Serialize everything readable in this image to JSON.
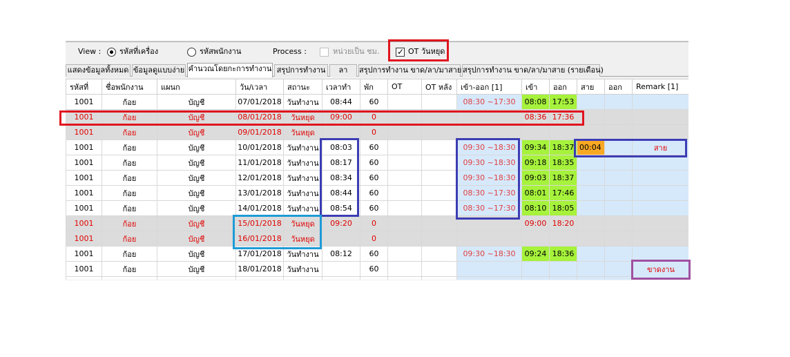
{
  "viewbar": {
    "view_label": "View :",
    "radio_machine_code": "รหัสที่เครื่อง",
    "radio_employee_code": "รหัสพนักงาน",
    "process_label": "Process :",
    "hour_unit_label": "หน่วยเป็น ชม.",
    "ot_holiday_label": "OT วันหยุด"
  },
  "tabs": [
    {
      "label": "แสดงข้อมูลทั้งหมด"
    },
    {
      "label": "ข้อมูลดูแบบง่าย"
    },
    {
      "label": "คำนวณโดยกะการทำงาน"
    },
    {
      "label": "สรุปการทำงาน"
    },
    {
      "label": "ลา"
    },
    {
      "label": "สรุปการทำงาน ขาด/ลา/มาสาย"
    },
    {
      "label": "สรุปการทำงาน ขาด/ลา/มาสาย (รายเดือน)"
    }
  ],
  "columns": [
    "รหัสที่",
    "ชื่อพนักงาน",
    "แผนก",
    "วัน/เวลา",
    "สถานะ",
    "เวลาทำ",
    "พัก",
    "OT",
    "OT หลัง",
    "เข้า-ออก [1]",
    "เข้า",
    "ออก",
    "สาย",
    "ออก",
    "Remark [1]"
  ],
  "rows": [
    {
      "id": "1001",
      "name": "ก้อย",
      "dept": "บัญชี",
      "date": "07/01/2018",
      "status": "วันทำงาน",
      "work": "08:44",
      "brk": "60",
      "ot": "",
      "ot_after": "",
      "shift": "08:30 ~17:30",
      "in": "08:08",
      "out": "17:53",
      "late": "",
      "early": "",
      "remark": ""
    },
    {
      "id": "1001",
      "name": "ก้อย",
      "dept": "บัญชี",
      "date": "08/01/2018",
      "status": "วันหยุด",
      "work": "09:00",
      "brk": "0",
      "ot": "",
      "ot_after": "",
      "shift": "",
      "in": "08:36",
      "out": "17:36",
      "late": "",
      "early": "",
      "remark": ""
    },
    {
      "id": "1001",
      "name": "ก้อย",
      "dept": "บัญชี",
      "date": "09/01/2018",
      "status": "วันหยุด",
      "work": "",
      "brk": "0",
      "ot": "",
      "ot_after": "",
      "shift": "",
      "in": "",
      "out": "",
      "late": "",
      "early": "",
      "remark": ""
    },
    {
      "id": "1001",
      "name": "ก้อย",
      "dept": "บัญชี",
      "date": "10/01/2018",
      "status": "วันทำงาน",
      "work": "08:03",
      "brk": "60",
      "ot": "",
      "ot_after": "",
      "shift": "09:30 ~18:30",
      "in": "09:34",
      "out": "18:37",
      "late": "00:04",
      "early": "",
      "remark": "สาย"
    },
    {
      "id": "1001",
      "name": "ก้อย",
      "dept": "บัญชี",
      "date": "11/01/2018",
      "status": "วันทำงาน",
      "work": "08:17",
      "brk": "60",
      "ot": "",
      "ot_after": "",
      "shift": "09:30 ~18:30",
      "in": "09:18",
      "out": "18:35",
      "late": "",
      "early": "",
      "remark": ""
    },
    {
      "id": "1001",
      "name": "ก้อย",
      "dept": "บัญชี",
      "date": "12/01/2018",
      "status": "วันทำงาน",
      "work": "08:34",
      "brk": "60",
      "ot": "",
      "ot_after": "",
      "shift": "09:30 ~18:30",
      "in": "09:03",
      "out": "18:37",
      "late": "",
      "early": "",
      "remark": ""
    },
    {
      "id": "1001",
      "name": "ก้อย",
      "dept": "บัญชี",
      "date": "13/01/2018",
      "status": "วันทำงาน",
      "work": "08:44",
      "brk": "60",
      "ot": "",
      "ot_after": "",
      "shift": "08:30 ~17:30",
      "in": "08:01",
      "out": "17:46",
      "late": "",
      "early": "",
      "remark": ""
    },
    {
      "id": "1001",
      "name": "ก้อย",
      "dept": "บัญชี",
      "date": "14/01/2018",
      "status": "วันทำงาน",
      "work": "08:54",
      "brk": "60",
      "ot": "",
      "ot_after": "",
      "shift": "08:30 ~17:30",
      "in": "08:10",
      "out": "18:05",
      "late": "",
      "early": "",
      "remark": ""
    },
    {
      "id": "1001",
      "name": "ก้อย",
      "dept": "บัญชี",
      "date": "15/01/2018",
      "status": "วันหยุด",
      "work": "09:20",
      "brk": "0",
      "ot": "",
      "ot_after": "",
      "shift": "",
      "in": "09:00",
      "out": "18:20",
      "late": "",
      "early": "",
      "remark": ""
    },
    {
      "id": "1001",
      "name": "ก้อย",
      "dept": "บัญชี",
      "date": "16/01/2018",
      "status": "วันหยุด",
      "work": "",
      "brk": "0",
      "ot": "",
      "ot_after": "",
      "shift": "",
      "in": "",
      "out": "",
      "late": "",
      "early": "",
      "remark": ""
    },
    {
      "id": "1001",
      "name": "ก้อย",
      "dept": "บัญชี",
      "date": "17/01/2018",
      "status": "วันทำงาน",
      "work": "08:12",
      "brk": "60",
      "ot": "",
      "ot_after": "",
      "shift": "09:30 ~18:30",
      "in": "09:24",
      "out": "18:36",
      "late": "",
      "early": "",
      "remark": ""
    },
    {
      "id": "1001",
      "name": "ก้อย",
      "dept": "บัญชี",
      "date": "18/01/2018",
      "status": "วันทำงาน",
      "work": "",
      "brk": "60",
      "ot": "",
      "ot_after": "",
      "shift": "",
      "in": "",
      "out": "",
      "late": "",
      "early": "",
      "remark": ""
    }
  ],
  "outside_remark": "ขาดงาน",
  "colors": {
    "highlight_red": "#e0141e",
    "highlight_blue": "#3c3cb4",
    "highlight_cyan": "#1e9bd7",
    "highlight_purple": "#a050a0",
    "in_out_green": "#a6f23c",
    "late_orange": "#f9a824",
    "holiday_text": "#e00000"
  }
}
